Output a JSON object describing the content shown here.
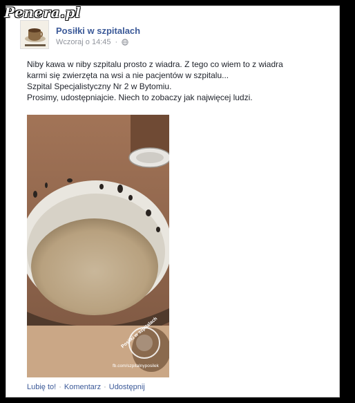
{
  "watermark": "Penera.pl",
  "post": {
    "page_name": "Posiłki w szpitalach",
    "timestamp": "Wczoraj o 14:45",
    "privacy_icon": "globe-icon",
    "text_lines": [
      "Niby kawa w niby szpitalu prosto z wiadra. Z tego co wiem to z wiadra",
      "karmi się zwierzęta na wsi a nie pacjentów w szpitalu...",
      "Szpital Specjalistyczny Nr 2 w Bytomiu.",
      "Prosimy, udostępniajcie. Niech to zobaczy jak najwięcej ludzi."
    ],
    "photo_stamp": {
      "title": "Posiłki w szpitalach",
      "url": "fb.com/szpitalnyposilek"
    }
  },
  "actions": {
    "like": "Lubię to!",
    "comment": "Komentarz",
    "share": "Udostępnij",
    "separator": "·"
  }
}
